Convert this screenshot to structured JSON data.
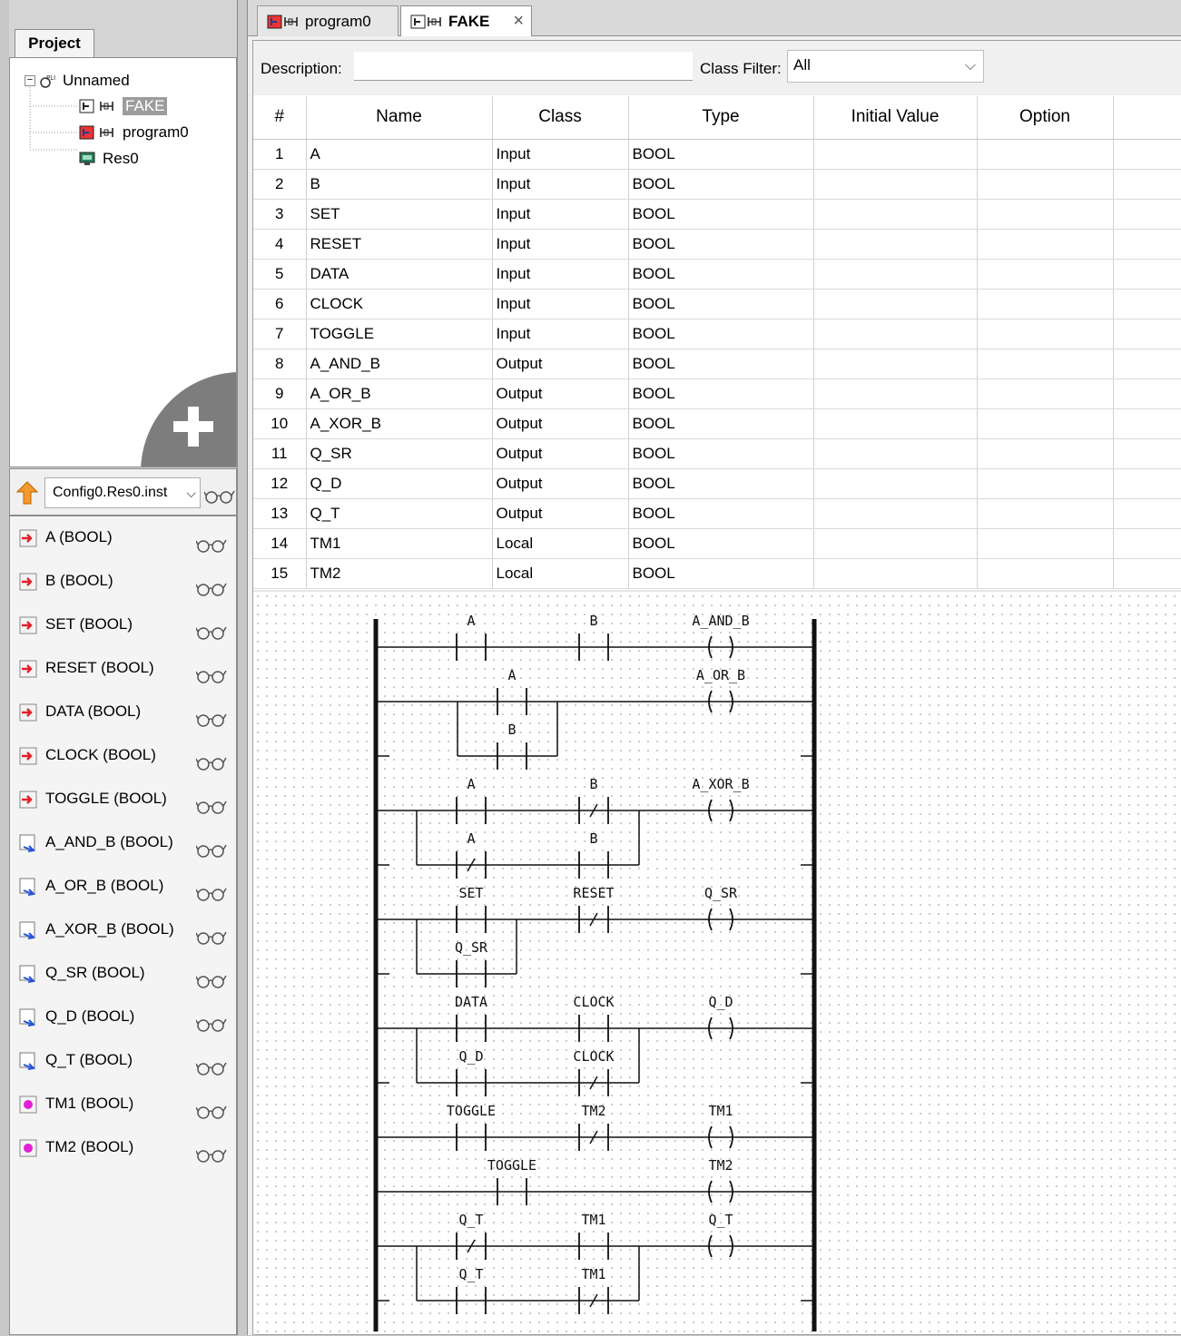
{
  "project_panel": {
    "tab_label": "Project",
    "tree": {
      "root": "Unnamed",
      "items": [
        "FAKE",
        "program0",
        "Res0"
      ]
    }
  },
  "debug": {
    "instance_select": "Config0.Res0.inst",
    "variables": [
      {
        "label": "A (BOOL)",
        "kind": "input"
      },
      {
        "label": "B (BOOL)",
        "kind": "input"
      },
      {
        "label": "SET (BOOL)",
        "kind": "input"
      },
      {
        "label": "RESET (BOOL)",
        "kind": "input"
      },
      {
        "label": "DATA (BOOL)",
        "kind": "input"
      },
      {
        "label": "CLOCK (BOOL)",
        "kind": "input"
      },
      {
        "label": "TOGGLE (BOOL)",
        "kind": "input"
      },
      {
        "label": "A_AND_B (BOOL)",
        "kind": "output"
      },
      {
        "label": "A_OR_B (BOOL)",
        "kind": "output"
      },
      {
        "label": "A_XOR_B (BOOL)",
        "kind": "output"
      },
      {
        "label": "Q_SR (BOOL)",
        "kind": "output"
      },
      {
        "label": "Q_D (BOOL)",
        "kind": "output"
      },
      {
        "label": "Q_T (BOOL)",
        "kind": "output"
      },
      {
        "label": "TM1 (BOOL)",
        "kind": "local"
      },
      {
        "label": "TM2 (BOOL)",
        "kind": "local"
      }
    ]
  },
  "tabs": [
    {
      "label": "program0",
      "active": false
    },
    {
      "label": "FAKE",
      "active": true,
      "close": "×"
    }
  ],
  "editor": {
    "description_label": "Description:",
    "description_value": "",
    "class_filter_label": "Class Filter:",
    "class_filter_value": "All",
    "columns": [
      "#",
      "Name",
      "Class",
      "Type",
      "Initial Value",
      "Option"
    ],
    "rows": [
      [
        "1",
        "A",
        "Input",
        "BOOL",
        "",
        ""
      ],
      [
        "2",
        "B",
        "Input",
        "BOOL",
        "",
        ""
      ],
      [
        "3",
        "SET",
        "Input",
        "BOOL",
        "",
        ""
      ],
      [
        "4",
        "RESET",
        "Input",
        "BOOL",
        "",
        ""
      ],
      [
        "5",
        "DATA",
        "Input",
        "BOOL",
        "",
        ""
      ],
      [
        "6",
        "CLOCK",
        "Input",
        "BOOL",
        "",
        ""
      ],
      [
        "7",
        "TOGGLE",
        "Input",
        "BOOL",
        "",
        ""
      ],
      [
        "8",
        "A_AND_B",
        "Output",
        "BOOL",
        "",
        ""
      ],
      [
        "9",
        "A_OR_B",
        "Output",
        "BOOL",
        "",
        ""
      ],
      [
        "10",
        "A_XOR_B",
        "Output",
        "BOOL",
        "",
        ""
      ],
      [
        "11",
        "Q_SR",
        "Output",
        "BOOL",
        "",
        ""
      ],
      [
        "12",
        "Q_D",
        "Output",
        "BOOL",
        "",
        ""
      ],
      [
        "13",
        "Q_T",
        "Output",
        "BOOL",
        "",
        ""
      ],
      [
        "14",
        "TM1",
        "Local",
        "BOOL",
        "",
        ""
      ],
      [
        "15",
        "TM2",
        "Local",
        "BOOL",
        "",
        ""
      ]
    ]
  },
  "ladder": {
    "rungs": [
      {
        "contacts": [
          {
            "name": "A",
            "neg": false
          },
          {
            "name": "B",
            "neg": false
          }
        ],
        "coil": "A_AND_B"
      },
      {
        "contacts": [
          {
            "name": "A",
            "neg": false
          }
        ],
        "parallel": [
          {
            "name": "B",
            "neg": false
          }
        ],
        "coil": "A_OR_B"
      },
      {
        "contacts": [
          {
            "name": "A",
            "neg": false
          },
          {
            "name": "B",
            "neg": true
          }
        ],
        "parallel": [
          {
            "name": "A",
            "neg": true
          },
          {
            "name": "B",
            "neg": false
          }
        ],
        "coil": "A_XOR_B"
      },
      {
        "contacts": [
          {
            "name": "SET",
            "neg": false
          },
          {
            "name": "RESET",
            "neg": true
          }
        ],
        "parallel": [
          {
            "name": "Q_SR",
            "neg": false
          }
        ],
        "coil": "Q_SR"
      },
      {
        "contacts": [
          {
            "name": "DATA",
            "neg": false
          },
          {
            "name": "CLOCK",
            "neg": false
          }
        ],
        "parallel": [
          {
            "name": "Q_D",
            "neg": false
          },
          {
            "name": "CLOCK",
            "neg": true
          }
        ],
        "coil": "Q_D"
      },
      {
        "contacts": [
          {
            "name": "TOGGLE",
            "neg": false
          },
          {
            "name": "TM2",
            "neg": true
          }
        ],
        "coil": "TM1"
      },
      {
        "contacts": [
          {
            "name": "TOGGLE",
            "neg": false
          }
        ],
        "coil": "TM2"
      },
      {
        "contacts": [
          {
            "name": "Q_T",
            "neg": true
          },
          {
            "name": "TM1",
            "neg": false
          }
        ],
        "parallel": [
          {
            "name": "Q_T",
            "neg": false
          },
          {
            "name": "TM1",
            "neg": true
          }
        ],
        "coil": "Q_T"
      }
    ]
  }
}
